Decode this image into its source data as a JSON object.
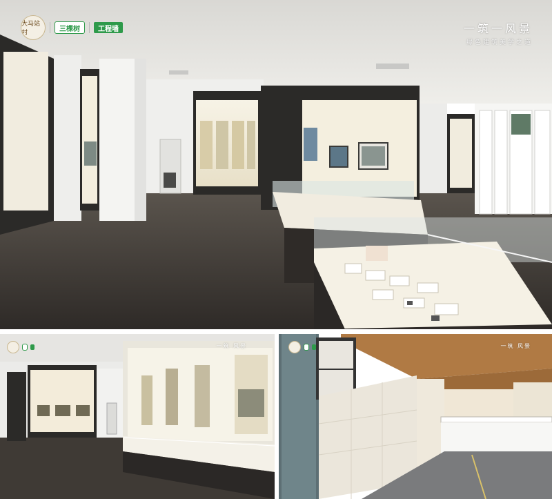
{
  "branding": {
    "round_logo_text": "大马站村",
    "pill_logo_text": "三棵树",
    "green_logo_text": "工程墙"
  },
  "slogan": {
    "main": "一筑一风景",
    "sub": "绿色建筑美学之道"
  },
  "slogan_small": {
    "main": "一筑 风景"
  },
  "colors": {
    "brand_green": "#2e9a4a",
    "floor_dark": "#3a3632",
    "ceiling_wood": "#b07a44"
  }
}
